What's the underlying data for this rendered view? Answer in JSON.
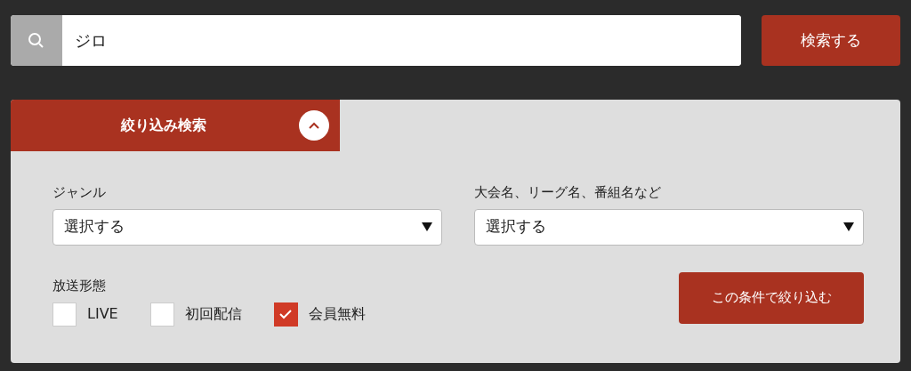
{
  "search": {
    "value": "ジロ",
    "button": "検索する"
  },
  "filter": {
    "title": "絞り込み検索",
    "expanded": true,
    "selects": [
      {
        "label": "ジャンル",
        "value": "選択する"
      },
      {
        "label": "大会名、リーグ名、番組名など",
        "value": "選択する"
      }
    ],
    "broadcast_label": "放送形態",
    "options": [
      {
        "label": "LIVE",
        "checked": false
      },
      {
        "label": "初回配信",
        "checked": false
      },
      {
        "label": "会員無料",
        "checked": true
      }
    ],
    "apply_button": "この条件で絞り込む"
  }
}
